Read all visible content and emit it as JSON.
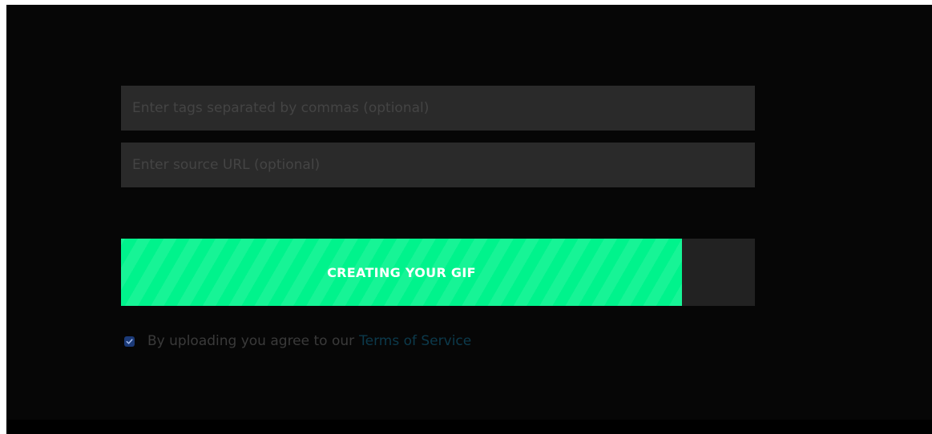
{
  "form": {
    "tags": {
      "placeholder": "Enter tags separated by commas (optional)",
      "value": ""
    },
    "source_url": {
      "placeholder": "Enter source URL (optional)",
      "value": ""
    }
  },
  "upload_button": {
    "label": "CREATING YOUR GIF",
    "progress_percent": 88.5,
    "fill_color": "#00f38c",
    "track_color": "#222222"
  },
  "agreement": {
    "checked": true,
    "text": "By uploading you agree to our",
    "link_text": "Terms of Service",
    "checkbox_color": "#1b3a78",
    "link_color": "#0c3a4c"
  },
  "icons": {
    "checkbox": "checkmark-icon"
  }
}
